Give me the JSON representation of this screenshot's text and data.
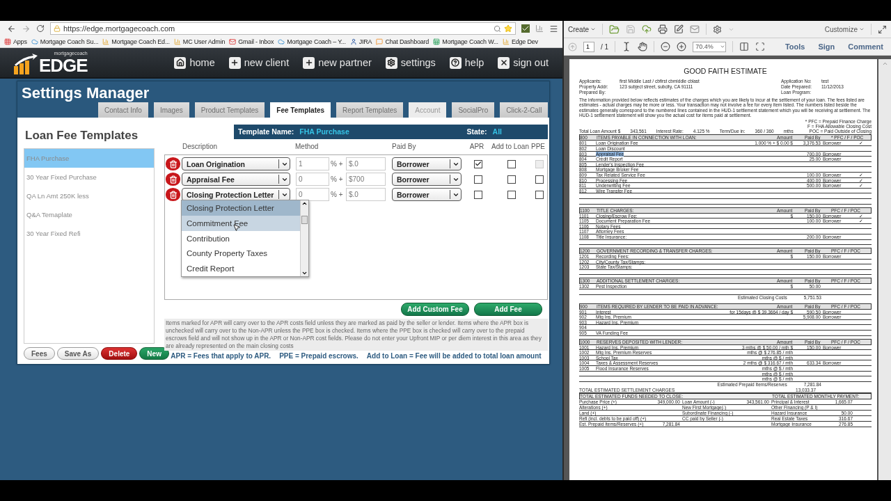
{
  "browser": {
    "url": "https://edge.mortgagecoach.com",
    "bookmarks": [
      {
        "label": "Apps",
        "kind": "apps"
      },
      {
        "label": "Mortgage Coach Su...",
        "kind": "cloud"
      },
      {
        "label": "Mortgage Coach Ed...",
        "kind": "chart"
      },
      {
        "label": "MC User Admin",
        "kind": "chart"
      },
      {
        "label": "Gmail - Inbox",
        "kind": "mail"
      },
      {
        "label": "Mortgage Coach – Y...",
        "kind": "cloud"
      },
      {
        "label": "JIRA",
        "kind": "user"
      },
      {
        "label": "Chat Dashboard",
        "kind": "chat"
      },
      {
        "label": "Mortgage Coach W...",
        "kind": "sheet"
      },
      {
        "label": "Edge Dev",
        "kind": "chart"
      }
    ]
  },
  "app": {
    "logo_small": "mortgagecoach",
    "logo_big": "EDGE",
    "nav": [
      {
        "label": "home",
        "kind": "home"
      },
      {
        "label": "new client",
        "kind": "plus"
      },
      {
        "label": "new partner",
        "kind": "plus"
      },
      {
        "label": "settings",
        "kind": "gear"
      },
      {
        "label": "help",
        "kind": "help"
      },
      {
        "label": "sign out",
        "kind": "close"
      }
    ]
  },
  "settings": {
    "title": "Settings Manager",
    "tabs": [
      {
        "label": "Contact Info",
        "selected": false,
        "disabled": false
      },
      {
        "label": "Images",
        "selected": false,
        "disabled": false
      },
      {
        "label": "Product Templates",
        "selected": false,
        "disabled": false
      },
      {
        "label": "Fee Templates",
        "selected": true,
        "disabled": false
      },
      {
        "label": "Report Templates",
        "selected": false,
        "disabled": false
      },
      {
        "label": "Account",
        "selected": false,
        "disabled": true
      },
      {
        "label": "SocialPro",
        "selected": false,
        "disabled": false
      },
      {
        "label": "Click-2-Call",
        "selected": false,
        "disabled": false
      }
    ]
  },
  "templates": {
    "title": "Loan Fee Templates",
    "items": [
      {
        "label": "FHA Purchase",
        "selected": true
      },
      {
        "label": "30 Year Fixed Purchase",
        "selected": false
      },
      {
        "label": "QA Ln Amt 250K less",
        "selected": false
      },
      {
        "label": "Q&A Temaplate",
        "selected": false
      },
      {
        "label": "30 Year Fixed Refi",
        "selected": false
      }
    ],
    "buttons": [
      {
        "label": "Fees",
        "kind": "plain"
      },
      {
        "label": "Save As",
        "kind": "plain"
      },
      {
        "label": "Delete",
        "kind": "danger"
      },
      {
        "label": "New",
        "kind": "success"
      }
    ]
  },
  "template_bar": {
    "name_label": "Template Name:",
    "name": "FHA Purchase",
    "state_label": "State:",
    "state": "All"
  },
  "columns": [
    "Description",
    "Method",
    "Paid By",
    "APR",
    "Add to Loan",
    "PPE"
  ],
  "fees": [
    {
      "description": "Loan Origination",
      "percent": "1",
      "operator": "% +",
      "amount": "$.0",
      "paid_by": "Borrower",
      "apr": {
        "checked": true,
        "disabled": false
      },
      "add_to_loan": {
        "checked": false,
        "disabled": false
      },
      "ppe": {
        "checked": false,
        "disabled": true
      }
    },
    {
      "description": "Appraisal Fee",
      "percent": "0",
      "operator": "% +",
      "amount": "$700",
      "paid_by": "Borrower",
      "apr": {
        "checked": false,
        "disabled": false
      },
      "add_to_loan": {
        "checked": false,
        "disabled": false
      },
      "ppe": {
        "checked": false,
        "disabled": false
      }
    },
    {
      "description": "Closing Protection Letter",
      "percent": "0",
      "operator": "% +",
      "amount": "$.0",
      "paid_by": "Borrower",
      "apr": {
        "checked": false,
        "disabled": false
      },
      "add_to_loan": {
        "checked": false,
        "disabled": false
      },
      "ppe": {
        "checked": false,
        "disabled": false
      }
    }
  ],
  "dropdown": {
    "items": [
      {
        "label": "Closing Protection Letter",
        "selected": true,
        "hovered": false
      },
      {
        "label": "Commitment Fee",
        "selected": false,
        "hovered": true
      },
      {
        "label": "Contribution",
        "selected": false,
        "hovered": false
      },
      {
        "label": "County Property Taxes",
        "selected": false,
        "hovered": false
      },
      {
        "label": "Credit Report",
        "selected": false,
        "hovered": false
      }
    ]
  },
  "actions": [
    "Add Custom Fee",
    "Add Fee"
  ],
  "note": "Items marked for APR will carry over to the APR costs field unless they are marked as paid by the seller or lender.  Items where the APR box is unchecked will carry over to the Non-APR unless the PPE box is checked.  Items where the PPE box is checked will carry over to the prepaid escrows field and will not show up in the APR or Non-APR cost fields.  Please do not enter your Upfront MIP or per diem interest in this area as they are already represented on the main closing costs",
  "legend": [
    "APR = Fees that apply to APR.",
    "PPE = Prepaid escrows.",
    "Add to Loan = Fee will be added to total loan amount"
  ],
  "reader": {
    "create": "Create",
    "customize": "Customize",
    "page": "1",
    "page_total": "/ 1",
    "zoom": "70.4%",
    "panes": [
      "Tools",
      "Sign",
      "Comment"
    ]
  },
  "document": {
    "title": "GOOD FAITH ESTIMATE",
    "info_left": [
      {
        "label": "Applicants:",
        "value": "first Middle Last / cbfirst cbmiddle cblast"
      },
      {
        "label": "Property Addr:",
        "value": "123 subject street, subcity, CA 91111"
      },
      {
        "label": "Prepared By:"
      }
    ],
    "info_right": [
      {
        "label": "Application No:",
        "value": "test"
      },
      {
        "label": "Date Prepared:",
        "value": "11/12/2013"
      },
      {
        "label": "Loan Program:"
      }
    ],
    "intro": "The information provided below reflects estimates of the charges which you are likely to incur at the settlement of your loan. The fees listed are estimates - actual charges may be more or less. Your transaction may not involve a fee for every item listed.  The numbers listed beside the estimates generally correspond to the numbered lines contained in the HUD-1 settlement statement which you will be receiving at settlement. The HUD-1 settlement statement will show you the actual cost for items paid at settlement.",
    "key": [
      "* PFC = Prepaid Finance Charge",
      "F = FHA Allowable Closing Cost",
      "POC = Paid Outside of Closing"
    ],
    "loan_line": [
      "Total Loan Amount $",
      "343,561",
      "Interest Rate:",
      "4.125 %",
      "Term/Due in:",
      "360 / 360",
      "mths"
    ],
    "sections": [
      {
        "num": "800",
        "title": "ITEMS PAYABLE IN CONNECTION WITH LOAN:",
        "columns": [
          "Amount",
          "Paid By",
          "* PFC / F / POC"
        ],
        "rows": [
          {
            "num": "801",
            "label": "Loan Origination Fee",
            "calc": "1.000 % + $      0.00 $",
            "amount": "3,376.53",
            "paid_by": "Borrower",
            "mark": "✓",
            "highlighted": false
          },
          {
            "num": "802",
            "label": "Loan Discount",
            "highlighted": false
          },
          {
            "num": "803",
            "label": "Appraisal Fee",
            "amount": "700.00",
            "paid_by": "Borrower",
            "highlighted": true
          },
          {
            "num": "804",
            "label": "Credit Report",
            "amount": "25.00",
            "paid_by": "Borrower",
            "highlighted": false
          },
          {
            "num": "805",
            "label": "Lender's Inspection Fee",
            "highlighted": false
          },
          {
            "num": "808",
            "label": "Mortgage Broker Fee",
            "highlighted": false
          },
          {
            "num": "809",
            "label": "Tax Related Service Fee",
            "amount": "100.00",
            "paid_by": "Borrower",
            "mark": "✓",
            "highlighted": false
          },
          {
            "num": "810",
            "label": "Processing Fee",
            "amount": "400.00",
            "paid_by": "Borrower",
            "mark": "✓",
            "highlighted": false
          },
          {
            "num": "811",
            "label": "Underwriting Fee",
            "amount": "500.00",
            "paid_by": "Borrower",
            "mark": "✓",
            "highlighted": false
          },
          {
            "num": "812",
            "label": "Wire Transfer Fee",
            "highlighted": false
          }
        ]
      },
      {
        "num": "1100",
        "title": "TITLE CHARGES:",
        "columns": [
          "Amount",
          "Paid By",
          "PFC / F / POC"
        ],
        "rows": [
          {
            "num": "1101",
            "label": "Closing/Escrow Fee:",
            "calc": "$",
            "amount": "150.00",
            "paid_by": "Borrower",
            "mark": "✓"
          },
          {
            "num": "1105",
            "label": "Document Preparation Fee",
            "amount": "100.00",
            "paid_by": "Borrower",
            "mark": "✓"
          },
          {
            "num": "1106",
            "label": "Notary Fees"
          },
          {
            "num": "1107",
            "label": "Attorney Fees"
          },
          {
            "num": "1108",
            "label": "Title Insurance:",
            "amount": "200.00",
            "paid_by": "Borrower"
          }
        ]
      },
      {
        "num": "1200",
        "title": "GOVERNMENT RECORDING & TRANSFER CHARGES:",
        "columns": [
          "Amount",
          "Paid By",
          "PFC / F / POC"
        ],
        "rows": [
          {
            "num": "1201",
            "label": "Recording Fees:",
            "calc": "$",
            "amount": "150.00",
            "paid_by": "Borrower"
          },
          {
            "num": "1202",
            "label": "City/County Tax/Stamps:"
          },
          {
            "num": "1203",
            "label": "State Tax/Stamps:"
          }
        ]
      },
      {
        "num": "1300",
        "title": "ADDITIONAL SETTLEMENT CHARGES:",
        "columns": [
          "Amount",
          "Paid By",
          "PFC / F / POC"
        ],
        "rows": [
          {
            "num": "1302",
            "label": "Pest Inspection",
            "calc": "$",
            "amount": "50.00"
          }
        ],
        "subtotal": {
          "label": "Estimated Closing Costs",
          "value": "5,751.53"
        }
      },
      {
        "num": "900",
        "title": "ITEMS REQUIRED BY LENDER TO BE PAID IN ADVANCE:",
        "columns": [
          "Amount",
          "Paid By",
          "PFC / F / POC"
        ],
        "rows": [
          {
            "num": "901",
            "label": "Interest",
            "calc": "for   15days @ $ 39.3664 / day $",
            "amount": "590.50",
            "paid_by": "Borrower"
          },
          {
            "num": "902",
            "label": "Mtg Ins. Premium",
            "amount": "5,908.00",
            "paid_by": "Borrower"
          },
          {
            "num": "903",
            "label": "Hazard Ins. Premium"
          },
          {
            "num": "904"
          },
          {
            "num": "905",
            "label": "VA Funding Fee"
          }
        ]
      },
      {
        "num": "1000",
        "title": "RESERVES DEPOSITED WITH LENDER:",
        "columns": [
          "Amount",
          "Paid By",
          "PFC / F / POC"
        ],
        "rows": [
          {
            "num": "1001",
            "label": "Hazard Ins. Premium",
            "calc": "3 mths @ $   50.00 / mth $",
            "amount": "150.00",
            "paid_by": "Borrower"
          },
          {
            "num": "1002",
            "label": "Mtg Ins. Premium Reserves",
            "calc": "mths @ $ 276.85 / mth"
          },
          {
            "num": "1003",
            "label": "School Tax",
            "calc": "mths @ $          / mth"
          },
          {
            "num": "1004",
            "label": "Taxes & Assessment Reserves",
            "calc": "2 mths @ $ 316.67 / mth",
            "amount": "633.34",
            "paid_by": "Borrower"
          },
          {
            "num": "1005",
            "label": "Flood Insurance Reserves",
            "calc": "mths @ $          / mth"
          },
          {
            "calc": "mths @ $          / mth"
          },
          {
            "calc": "mths @ $          / mth"
          }
        ],
        "subtotal": {
          "label": "Estimated Prepaid Items/Reserves",
          "value": "7,281.84"
        }
      }
    ],
    "grand_total": {
      "label": "TOTAL ESTIMATED SETTLEMENT CHARGES",
      "value": "13,033.37"
    },
    "funds_title": "TOTAL ESTIMATED FUNDS NEEDED TO CLOSE:",
    "monthly_title": "TOTAL ESTIMATED MONTHLY PAYMENT:",
    "funds": [
      {
        "a": "Purchase Price (+)",
        "a_value": "349,000.00",
        "b": "Loan Amount (-)",
        "b_value": "343,561.00",
        "c": "Principal & Interest",
        "c_value": "1,665.07"
      },
      {
        "a": "Alterations (+)",
        "b": "New First Mortgage(-)",
        "c": "Other Financing (P & I)"
      },
      {
        "a": "Land (+)",
        "b": "Subordinate Financing (-)",
        "c": "Hazard Insurance",
        "c_value": "50.00"
      },
      {
        "a": "Refi (incl. debts to be paid off) (+)",
        "b": "CC paid by Seller (-)",
        "c": "Real Estate Taxes",
        "c_value": "316.67"
      },
      {
        "a": "Est. Prepaid Items/Reserves (+)",
        "a_value": "7,281.84",
        "c": "Mortgage Insurance",
        "c_value": "276.85"
      }
    ]
  }
}
